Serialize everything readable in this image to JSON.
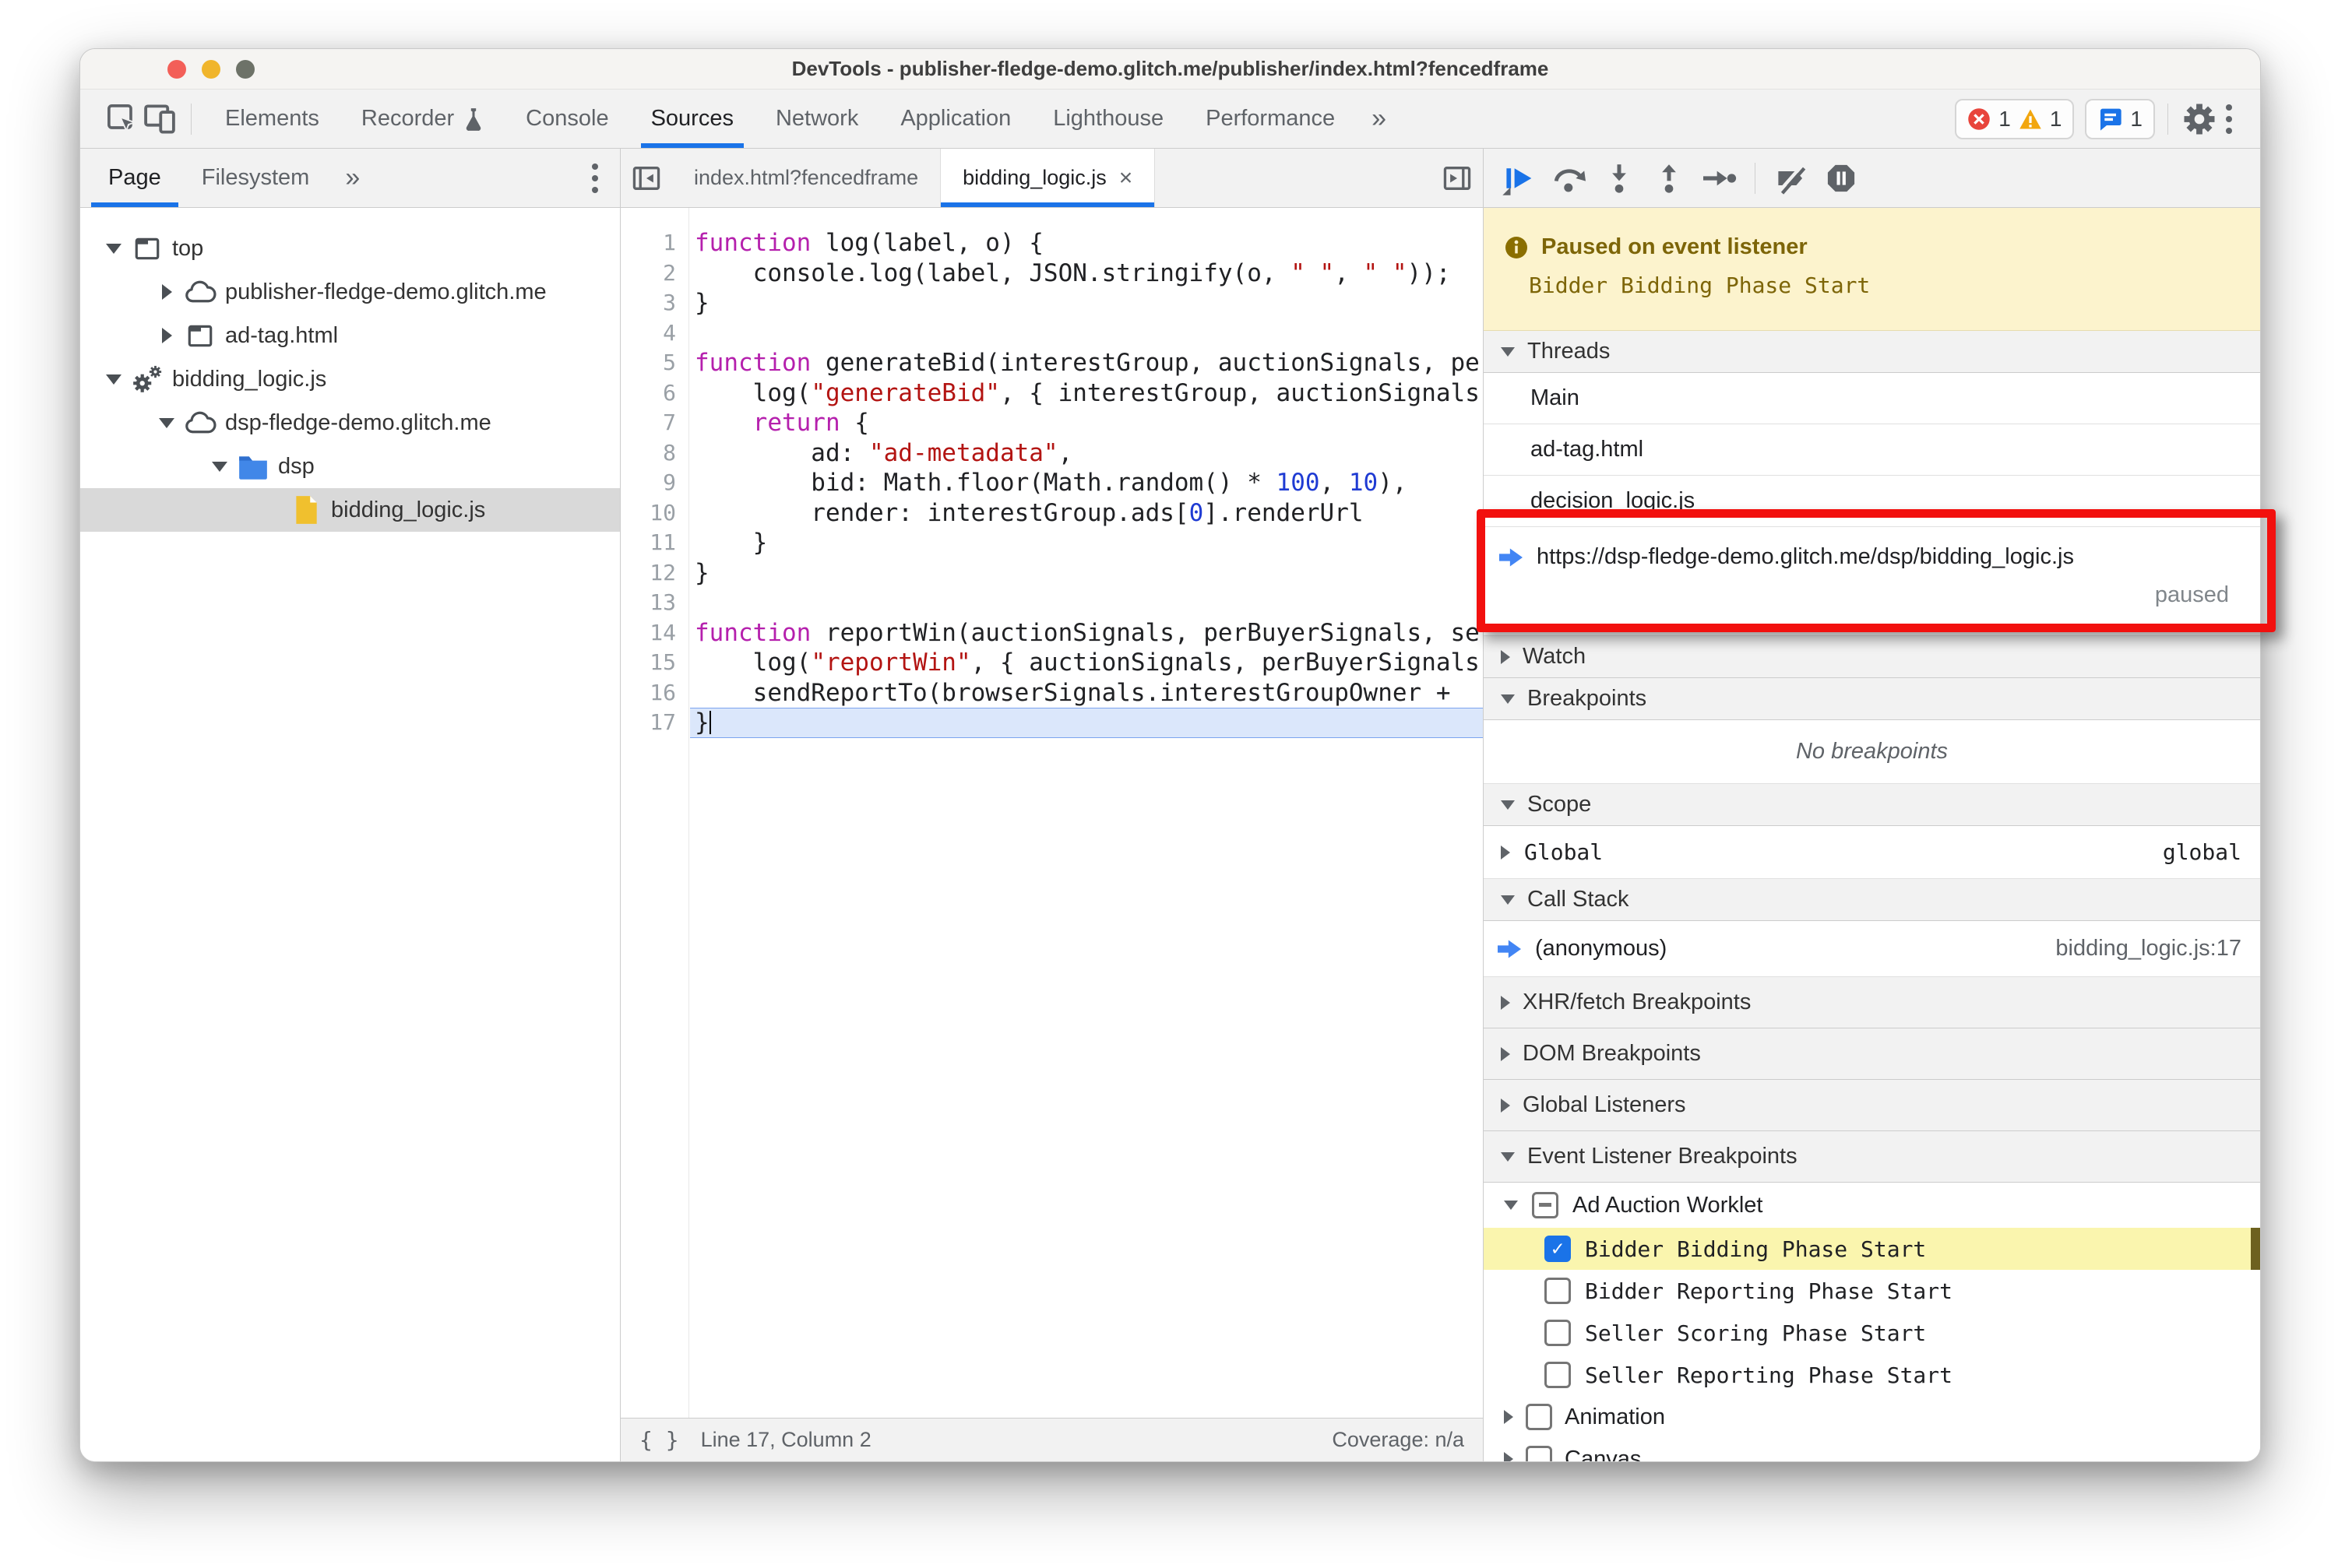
{
  "window": {
    "title": "DevTools - publisher-fledge-demo.glitch.me/publisher/index.html?fencedframe"
  },
  "toolbar": {
    "tabs": [
      {
        "label": "Elements",
        "selected": false,
        "icon": null
      },
      {
        "label": "Recorder",
        "selected": false,
        "icon": "flask"
      },
      {
        "label": "Console",
        "selected": false,
        "icon": null
      },
      {
        "label": "Sources",
        "selected": true,
        "icon": null
      },
      {
        "label": "Network",
        "selected": false,
        "icon": null
      },
      {
        "label": "Application",
        "selected": false,
        "icon": null
      },
      {
        "label": "Lighthouse",
        "selected": false,
        "icon": null
      },
      {
        "label": "Performance",
        "selected": false,
        "icon": null
      }
    ],
    "overflow_symbol": "»",
    "error_count": "1",
    "warning_count": "1",
    "issues_count": "1"
  },
  "nav": {
    "tabs": [
      {
        "label": "Page",
        "selected": true
      },
      {
        "label": "Filesystem",
        "selected": false
      }
    ],
    "overflow_symbol": "»",
    "tree": [
      {
        "label": "top",
        "icon": "frame",
        "arrow": "expanded",
        "level": 0,
        "selected": false
      },
      {
        "label": "publisher-fledge-demo.glitch.me",
        "icon": "cloud",
        "arrow": "collapsed",
        "level": 1,
        "selected": false
      },
      {
        "label": "ad-tag.html",
        "icon": "frame",
        "arrow": "collapsed",
        "level": 1,
        "selected": false
      },
      {
        "label": "bidding_logic.js",
        "icon": "worker",
        "arrow": "expanded",
        "level": 0,
        "selected": false
      },
      {
        "label": "dsp-fledge-demo.glitch.me",
        "icon": "cloud",
        "arrow": "expanded",
        "level": 1,
        "selected": false
      },
      {
        "label": "dsp",
        "icon": "folder",
        "arrow": "expanded",
        "level": 2,
        "selected": false
      },
      {
        "label": "bidding_logic.js",
        "icon": "file",
        "arrow": "none",
        "level": 3,
        "selected": true
      }
    ]
  },
  "editor": {
    "tabs": [
      {
        "label": "index.html?fencedframe",
        "active": false
      },
      {
        "label": "bidding_logic.js",
        "active": true
      }
    ],
    "close_symbol": "×",
    "status_left": "Line 17, Column 2",
    "status_right": "Coverage: n/a",
    "active_line": 17,
    "code_lines": [
      [
        {
          "t": "k",
          "v": "function"
        },
        {
          "t": "p",
          "v": " log(label, o) {"
        }
      ],
      [
        {
          "t": "p",
          "v": "    console.log(label, JSON.stringify(o, "
        },
        {
          "t": "s",
          "v": "\" \""
        },
        {
          "t": "p",
          "v": ", "
        },
        {
          "t": "s",
          "v": "\" \""
        },
        {
          "t": "p",
          "v": "));"
        }
      ],
      [
        {
          "t": "p",
          "v": "}"
        }
      ],
      [],
      [
        {
          "t": "k",
          "v": "function"
        },
        {
          "t": "p",
          "v": " generateBid(interestGroup, auctionSignals, perBuyerSignals, trustedBiddingSignals, browserSignals) {"
        }
      ],
      [
        {
          "t": "p",
          "v": "    log("
        },
        {
          "t": "s",
          "v": "\"generateBid\""
        },
        {
          "t": "p",
          "v": ", { interestGroup, auctionSignals, perBuyerSignals });"
        }
      ],
      [
        {
          "t": "p",
          "v": "    "
        },
        {
          "t": "k",
          "v": "return"
        },
        {
          "t": "p",
          "v": " {"
        }
      ],
      [
        {
          "t": "p",
          "v": "        ad: "
        },
        {
          "t": "s",
          "v": "\"ad-metadata\""
        },
        {
          "t": "p",
          "v": ","
        }
      ],
      [
        {
          "t": "p",
          "v": "        bid: Math.floor(Math.random() * "
        },
        {
          "t": "n",
          "v": "100"
        },
        {
          "t": "p",
          "v": ", "
        },
        {
          "t": "n",
          "v": "10"
        },
        {
          "t": "p",
          "v": "),"
        }
      ],
      [
        {
          "t": "p",
          "v": "        render: interestGroup.ads["
        },
        {
          "t": "n",
          "v": "0"
        },
        {
          "t": "p",
          "v": "].renderUrl"
        }
      ],
      [
        {
          "t": "p",
          "v": "    }"
        }
      ],
      [
        {
          "t": "p",
          "v": "}"
        }
      ],
      [],
      [
        {
          "t": "k",
          "v": "function"
        },
        {
          "t": "p",
          "v": " reportWin(auctionSignals, perBuyerSignals, sellerSignals, browserSignals) {"
        }
      ],
      [
        {
          "t": "p",
          "v": "    log("
        },
        {
          "t": "s",
          "v": "\"reportWin\""
        },
        {
          "t": "p",
          "v": ", { auctionSignals, perBuyerSignals, sellerSignals });"
        }
      ],
      [
        {
          "t": "p",
          "v": "    sendReportTo(browserSignals.interestGroupOwner + "
        }
      ],
      [
        {
          "t": "p",
          "v": "}"
        }
      ]
    ]
  },
  "debugger": {
    "banner": {
      "title": "Paused on event listener",
      "detail": "Bidder Bidding Phase Start"
    },
    "threads": {
      "header": "Threads",
      "rows": [
        "Main",
        "ad-tag.html",
        "decision_logic.js"
      ],
      "active": {
        "url": "https://dsp-fledge-demo.glitch.me/dsp/bidding_logic.js",
        "status": "paused"
      }
    },
    "watch": {
      "header": "Watch"
    },
    "breakpoints": {
      "header": "Breakpoints",
      "empty_text": "No breakpoints"
    },
    "scope": {
      "header": "Scope",
      "name": "Global",
      "value": "global"
    },
    "call_stack": {
      "header": "Call Stack",
      "frame": "(anonymous)",
      "location": "bidding_logic.js:17"
    },
    "xhr": {
      "header": "XHR/fetch Breakpoints"
    },
    "dom": {
      "header": "DOM Breakpoints"
    },
    "global_listeners": {
      "header": "Global Listeners"
    },
    "elb": {
      "header": "Event Listener Breakpoints",
      "group": {
        "label": "Ad Auction Worklet",
        "state": "indeterminate"
      },
      "children": [
        {
          "label": "Bidder Bidding Phase Start",
          "checked": true,
          "highlighted": true
        },
        {
          "label": "Bidder Reporting Phase Start",
          "checked": false,
          "highlighted": false
        },
        {
          "label": "Seller Scoring Phase Start",
          "checked": false,
          "highlighted": false
        },
        {
          "label": "Seller Reporting Phase Start",
          "checked": false,
          "highlighted": false
        }
      ],
      "categories": [
        {
          "label": "Animation"
        },
        {
          "label": "Canvas"
        }
      ]
    },
    "check_glyph": "✓"
  },
  "colors": {
    "accent": "#1a73e8",
    "annotation_red": "#f2100e",
    "paused_banner_bg": "#fcf3cd",
    "highlight_yellow": "#faf5ae"
  }
}
